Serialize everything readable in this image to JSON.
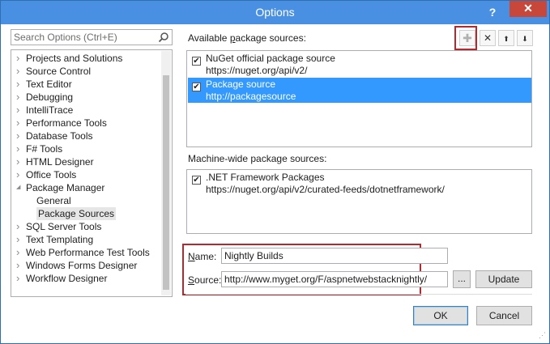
{
  "window": {
    "title": "Options",
    "help_label": "?",
    "close_label": "✕"
  },
  "search": {
    "placeholder": "Search Options (Ctrl+E)"
  },
  "tree": [
    {
      "label": "Projects and Solutions",
      "expanded": false
    },
    {
      "label": "Source Control",
      "expanded": false
    },
    {
      "label": "Text Editor",
      "expanded": false
    },
    {
      "label": "Debugging",
      "expanded": false
    },
    {
      "label": "IntelliTrace",
      "expanded": false
    },
    {
      "label": "Performance Tools",
      "expanded": false
    },
    {
      "label": "Database Tools",
      "expanded": false
    },
    {
      "label": "F# Tools",
      "expanded": false
    },
    {
      "label": "HTML Designer",
      "expanded": false
    },
    {
      "label": "Office Tools",
      "expanded": false
    },
    {
      "label": "Package Manager",
      "expanded": true
    },
    {
      "label": "General",
      "child": true
    },
    {
      "label": "Package Sources",
      "child": true,
      "selected": true
    },
    {
      "label": "SQL Server Tools",
      "expanded": false
    },
    {
      "label": "Text Templating",
      "expanded": false
    },
    {
      "label": "Web Performance Test Tools",
      "expanded": false
    },
    {
      "label": "Windows Forms Designer",
      "expanded": false
    },
    {
      "label": "Workflow Designer",
      "expanded": false
    }
  ],
  "available": {
    "label_prefix": "Available ",
    "label_accel": "p",
    "label_suffix": "ackage sources:",
    "sources": [
      {
        "name": "NuGet official package source",
        "url": "https://nuget.org/api/v2/",
        "checked": true,
        "selected": false
      },
      {
        "name": "Package source",
        "url": "http://packagesource",
        "checked": true,
        "selected": true
      }
    ]
  },
  "toolbar": {
    "add_icon": "add-icon",
    "remove_icon": "remove-icon",
    "up_icon": "move-up-icon",
    "down_icon": "move-down-icon",
    "add_glyph": "✚",
    "remove_glyph": "✕",
    "up_glyph": "⬆",
    "down_glyph": "⬇"
  },
  "machine_wide": {
    "label": "Machine-wide package sources:",
    "sources": [
      {
        "name": ".NET Framework Packages",
        "url": "https://nuget.org/api/v2/curated-feeds/dotnetframework/",
        "checked": true
      }
    ]
  },
  "form": {
    "name_label_accel": "N",
    "name_label_rest": "ame:",
    "name_value": "Nightly Builds",
    "source_label_accel": "S",
    "source_label_rest": "ource:",
    "source_value": "http://www.myget.org/F/aspnetwebstacknightly/",
    "browse_label": "...",
    "update_label": "Update"
  },
  "footer": {
    "ok_label": "OK",
    "cancel_label": "Cancel"
  },
  "colors": {
    "titlebar": "#4a90e2",
    "selection": "#3399ff",
    "highlight_box": "#b5282e",
    "close_button": "#c7483b"
  }
}
